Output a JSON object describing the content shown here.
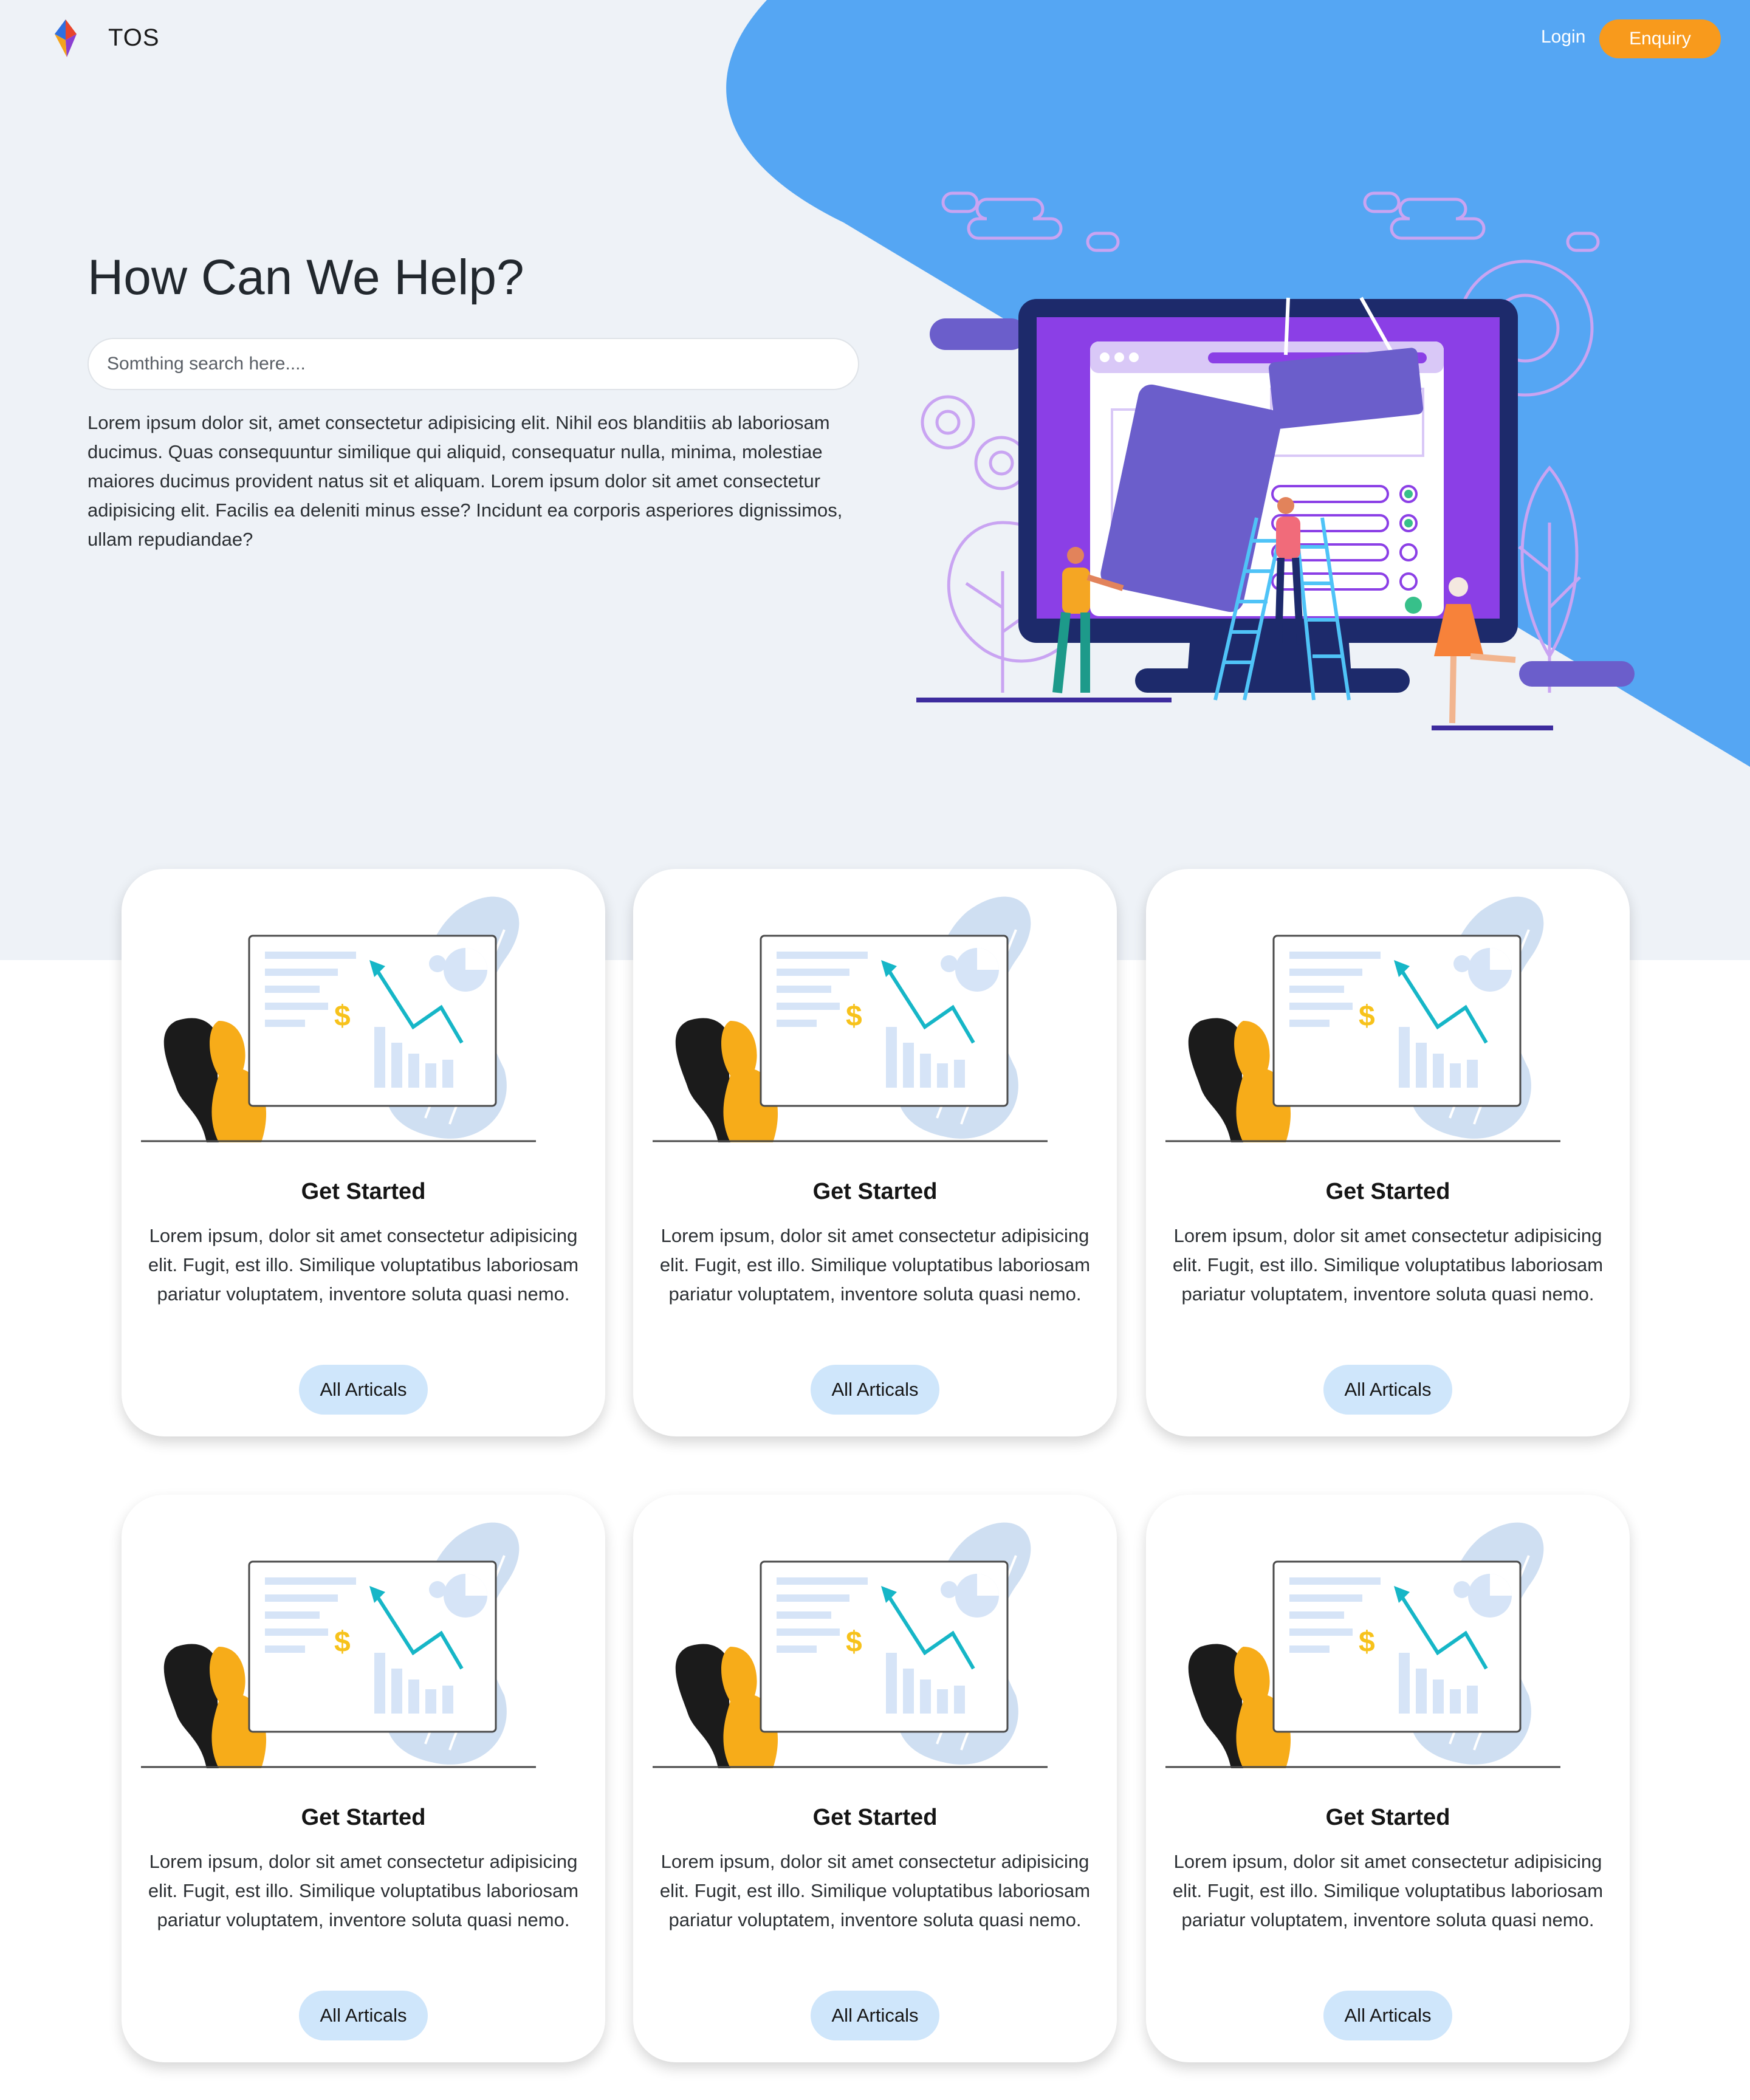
{
  "nav": {
    "brand": "TOS",
    "login_label": "Login",
    "enquiry_label": "Enquiry"
  },
  "hero": {
    "title": "How Can We Help?",
    "search_placeholder": "Somthing search here....",
    "description": "Lorem ipsum dolor sit, amet consectetur adipisicing elit. Nihil eos blanditiis ab laboriosam ducimus. Quas consequuntur similique qui aliquid, consequatur nulla, minima, molestiae maiores ducimus provident natus sit et aliquam. Lorem ipsum dolor sit amet consectetur adipisicing elit. Facilis ea deleniti minus esse? Incidunt ea corporis asperiores dignissimos, ullam repudiandae?"
  },
  "cards": [
    {
      "title": "Get Started",
      "text": "Lorem ipsum, dolor sit amet consectetur adipisicing elit. Fugit, est illo. Similique voluptatibus laboriosam pariatur voluptatem, inventore soluta quasi nemo.",
      "button": "All Articals"
    },
    {
      "title": "Get Started",
      "text": "Lorem ipsum, dolor sit amet consectetur adipisicing elit. Fugit, est illo. Similique voluptatibus laboriosam pariatur voluptatem, inventore soluta quasi nemo.",
      "button": "All Articals"
    },
    {
      "title": "Get Started",
      "text": "Lorem ipsum, dolor sit amet consectetur adipisicing elit. Fugit, est illo. Similique voluptatibus laboriosam pariatur voluptatem, inventore soluta quasi nemo.",
      "button": "All Articals"
    },
    {
      "title": "Get Started",
      "text": "Lorem ipsum, dolor sit amet consectetur adipisicing elit. Fugit, est illo. Similique voluptatibus laboriosam pariatur voluptatem, inventore soluta quasi nemo.",
      "button": "All Articals"
    },
    {
      "title": "Get Started",
      "text": "Lorem ipsum, dolor sit amet consectetur adipisicing elit. Fugit, est illo. Similique voluptatibus laboriosam pariatur voluptatem, inventore soluta quasi nemo.",
      "button": "All Articals"
    },
    {
      "title": "Get Started",
      "text": "Lorem ipsum, dolor sit amet consectetur adipisicing elit. Fugit, est illo. Similique voluptatibus laboriosam pariatur voluptatem, inventore soluta quasi nemo.",
      "button": "All Articals"
    }
  ],
  "colors": {
    "hero_background": "#eef2f7",
    "accent_blue": "#55a6f3",
    "enquiry_orange": "#f89a1c",
    "card_button": "#cfe6fb"
  }
}
